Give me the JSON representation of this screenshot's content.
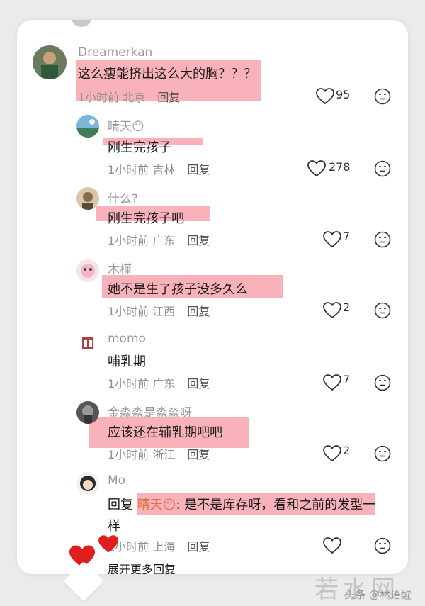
{
  "comments": [
    {
      "name": "Dreamerkan",
      "text": "这么瘦能挤出这么大的胸？？？",
      "time": "1小时前",
      "location": "北京",
      "reply": "回复",
      "likes": "95"
    },
    {
      "name": "晴天😶",
      "text": "刚生完孩子",
      "time": "1小时前",
      "location": "吉林",
      "reply": "回复",
      "likes": "278"
    },
    {
      "name": "什么?",
      "text": "刚生完孩子吧",
      "time": "1小时前",
      "location": "广东",
      "reply": "回复",
      "likes": "7"
    },
    {
      "name": "木槿",
      "text": "她不是生了孩子没多久么",
      "time": "1小时前",
      "location": "江西",
      "reply": "回复",
      "likes": "2"
    },
    {
      "name": "momo",
      "text": "哺乳期",
      "time": "1小时前",
      "location": "广东",
      "reply": "回复",
      "likes": "7"
    },
    {
      "name": "金淼淼是淼淼呀",
      "text": "应该还在辅乳期吧吧",
      "time": "1小时前",
      "location": "浙江",
      "reply": "回复",
      "likes": "2"
    },
    {
      "name": "Mo",
      "reply_prefix": "回复",
      "mention": "晴天😶",
      "text_line1": ": 是不是库存呀，看和之前的发型一",
      "text_line2": "样",
      "time": "1小时前",
      "location": "上海",
      "reply": "回复",
      "likes": ""
    }
  ],
  "expand_more": "展开更多回复",
  "watermark": {
    "big": "若水网",
    "small": "头条 @林语醒"
  },
  "colors": {
    "highlight": "#f57382",
    "card": "#ffffff",
    "background": "#ebebeb"
  }
}
